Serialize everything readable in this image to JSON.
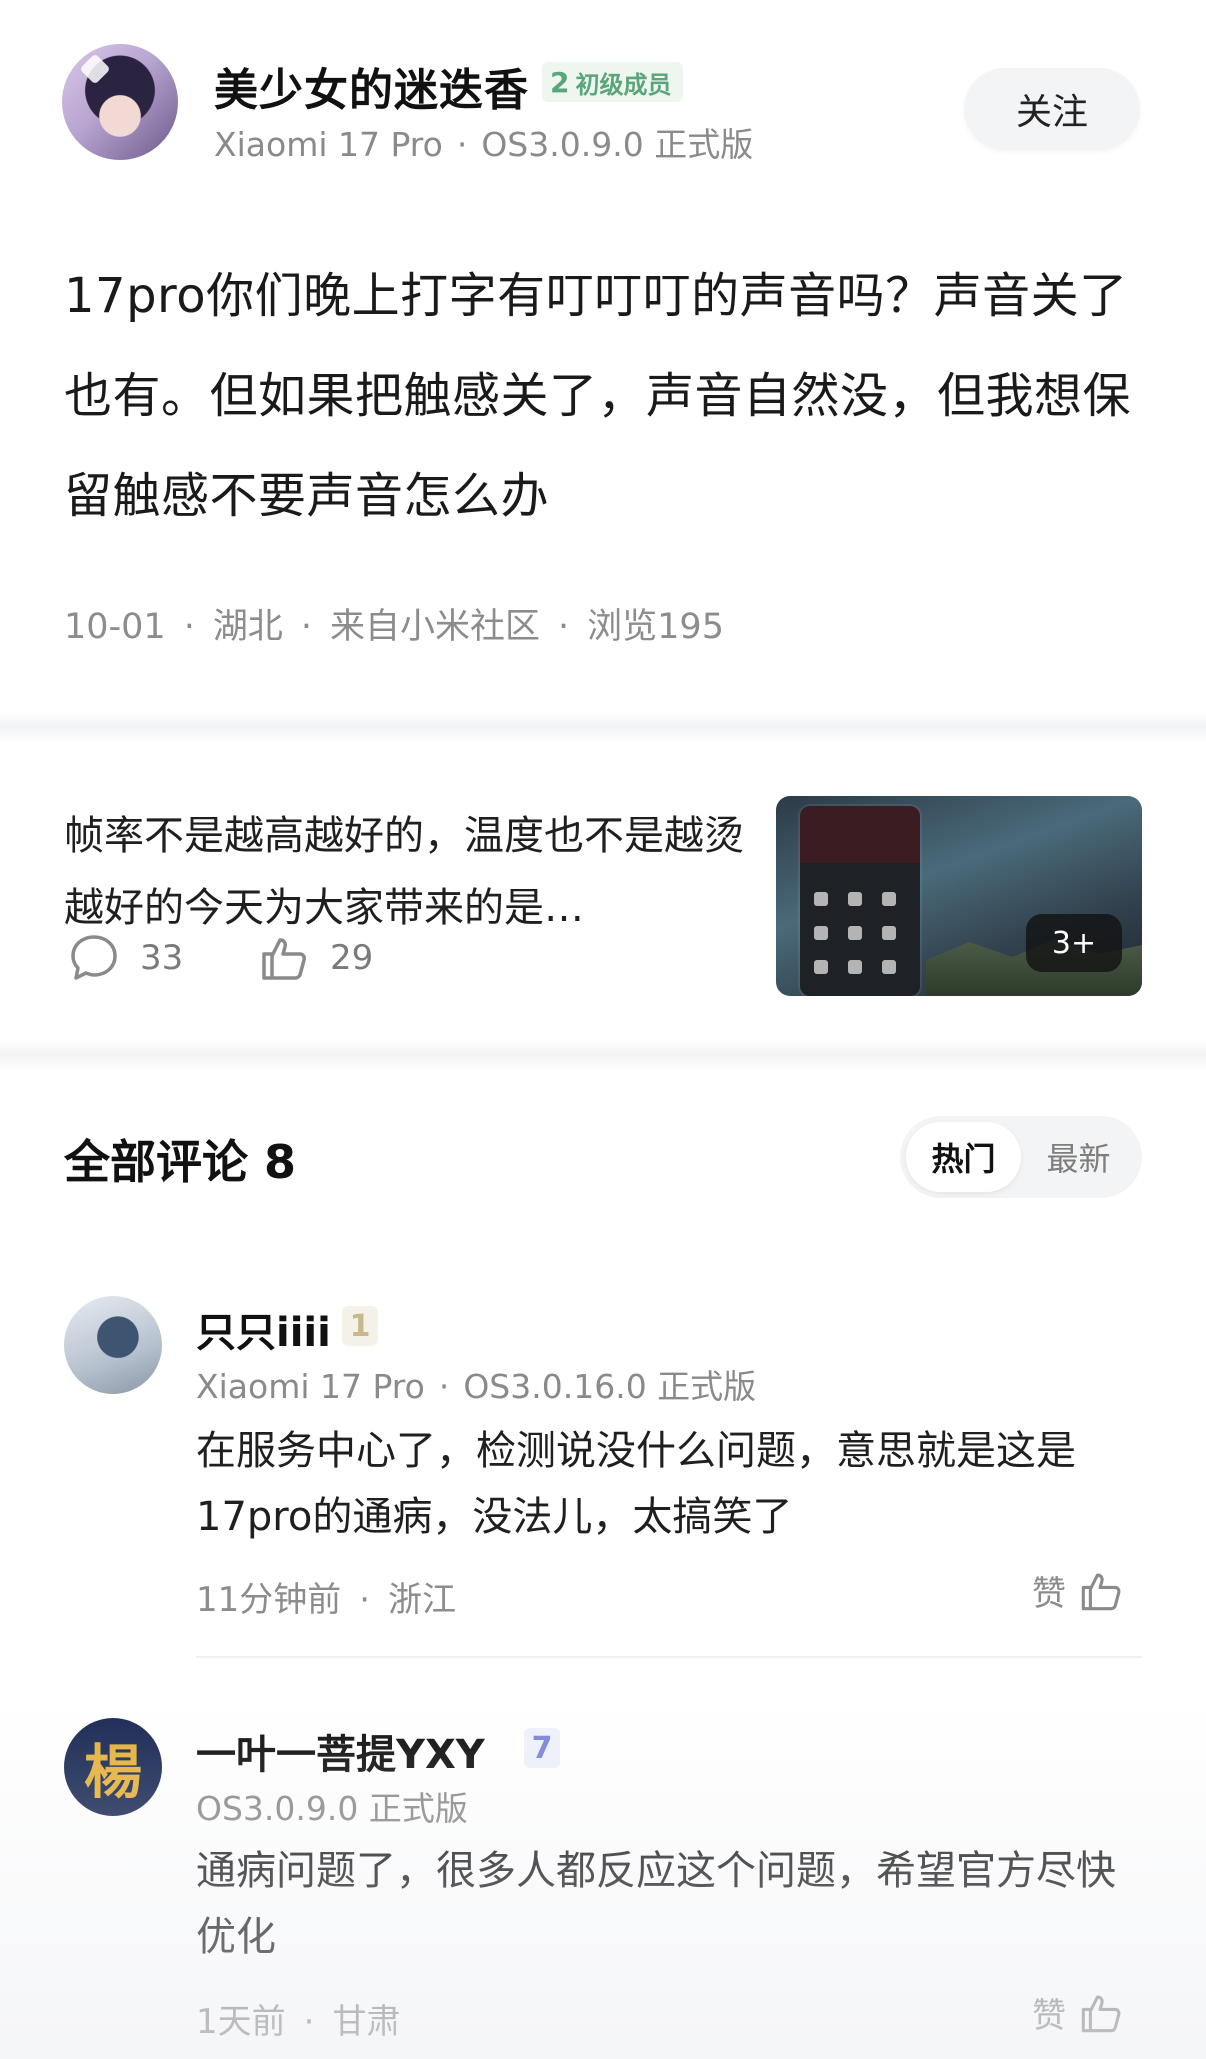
{
  "post": {
    "author": {
      "name": "美少女的迷迭香",
      "level": "2",
      "level_title": "初级成员",
      "device": "Xiaomi 17 Pro",
      "os": "OS3.0.9.0 正式版"
    },
    "follow_label": "关注",
    "content": "17pro你们晚上打字有叮叮叮的声音吗？声音关了也有。但如果把触感关了，声音自然没，但我想保留触感不要声音怎么办",
    "meta": {
      "date": "10-01",
      "location": "湖北",
      "source": "来自小米社区",
      "views": "浏览195"
    }
  },
  "related": {
    "title": "帧率不是越高越好的，温度也不是越烫越好的今天为大家带来的是…",
    "comments": "33",
    "likes": "29",
    "more_images": "3+"
  },
  "comments_section": {
    "title": "全部评论 8",
    "sort_hot": "热门",
    "sort_new": "最新",
    "items": [
      {
        "name": "只只iiii",
        "level": "1",
        "device": "Xiaomi 17 Pro",
        "os": "OS3.0.16.0 正式版",
        "text": "在服务中心了，检测说没什么问题，意思就是这是17pro的通病，没法儿，太搞笑了",
        "time": "11分钟前",
        "location": "浙江",
        "like_label": "赞"
      },
      {
        "name": "一叶一菩提YXY",
        "level": "7",
        "avatar_char": "楊",
        "os": "OS3.0.9.0 正式版",
        "text": "通病问题了，很多人都反应这个问题，希望官方尽快优化",
        "time": "1天前",
        "location": "甘肃",
        "like_label": "赞"
      }
    ]
  }
}
